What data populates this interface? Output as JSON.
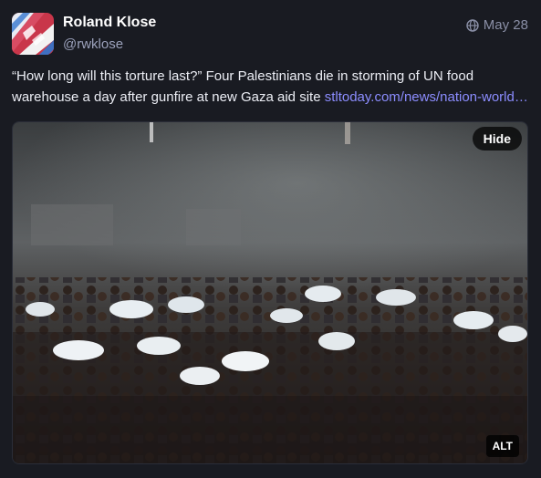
{
  "post": {
    "author": {
      "display_name": "Roland Klose",
      "handle": "@rwklose"
    },
    "visibility_icon": "globe-icon",
    "date": "May 28",
    "text_line_1": "“How long will this torture last?” Four Palestinians die in storming of UN food",
    "text_line_2_prefix": "warehouse a day after gunfire at new Gaza aid site ",
    "link_text": "stltoday.com/news/nation-world…",
    "media": {
      "hide_label": "Hide",
      "alt_label": "ALT"
    }
  },
  "colors": {
    "background": "#191b22",
    "link": "#8c8dff",
    "muted": "#9ba1bb"
  }
}
